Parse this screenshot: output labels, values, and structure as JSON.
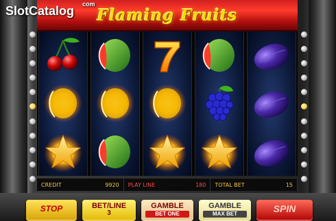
{
  "watermark": {
    "part1": "Slot",
    "part2": "Catalog",
    "domain": "com"
  },
  "game": {
    "title": "Flaming Fruits"
  },
  "reels": [
    [
      "cherries-icon",
      "burning-melon-icon",
      "burning-star-icon"
    ],
    [
      "watermelon-icon",
      "burning-melon-icon",
      "watermelon-icon"
    ],
    [
      "seven-icon",
      "burning-melon-icon",
      "burning-star-icon"
    ],
    [
      "watermelon-icon",
      "grapes-icon",
      "burning-star-icon"
    ],
    [
      "plum-icon",
      "plum-icon",
      "plum-icon"
    ]
  ],
  "info": {
    "credit_label": "CREDIT",
    "credit_value": "9920",
    "playline_label": "PLAY LINE",
    "playline_value": "180",
    "totalbet_label": "TOTAL BET",
    "totalbet_value": "15"
  },
  "buttons": {
    "stop": "STOP",
    "betline_label": "BET/LINE",
    "betline_value": "3",
    "gamble1_label": "GAMBLE",
    "gamble1_sub": "BET ONE",
    "gamble2_label": "GAMBLE",
    "gamble2_sub": "MAX BET",
    "spin": "SPIN"
  },
  "colors": {
    "banner": "#d12020",
    "credit_text": "#f4c44a",
    "playline_text": "#ff4a4a",
    "reel_bg": "#0d1a3a"
  }
}
